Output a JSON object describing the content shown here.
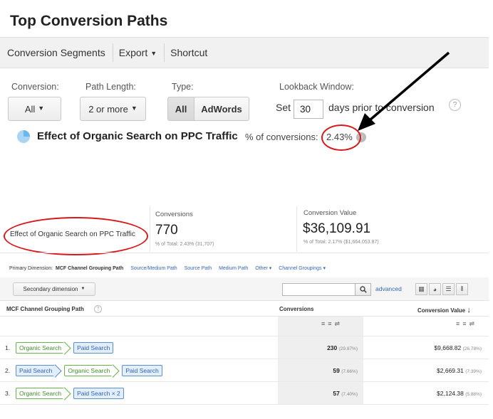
{
  "page_title": "Top Conversion Paths",
  "toolbar": {
    "conversion_segments": "Conversion Segments",
    "export": "Export",
    "shortcut": "Shortcut"
  },
  "filters": {
    "conversion_label": "Conversion:",
    "conversion_value": "All",
    "path_length_label": "Path Length:",
    "path_length_value": "2 or more",
    "type_label": "Type:",
    "type_options": [
      "All",
      "AdWords"
    ],
    "lookback_label": "Lookback Window:",
    "lookback_prefix": "Set",
    "lookback_days": "30",
    "lookback_suffix": "days prior to conversion",
    "help": "?"
  },
  "segment": {
    "name": "Effect of Organic Search on PPC Traffic",
    "pct_label": "% of conversions:",
    "pct_value": "2.43%",
    "close": "×"
  },
  "summary": {
    "segment_label": "Effect of Organic Search on PPC Traffic",
    "conversions_label": "Conversions",
    "conversions_value": "770",
    "conversions_sub": "% of Total: 2.43% (31,707)",
    "value_label": "Conversion Value",
    "value_value": "$36,109.91",
    "value_sub": "% of Total: 2.17% ($1,664,053.87)"
  },
  "dimensions": {
    "label": "Primary Dimension:",
    "active": "MCF Channel Grouping Path",
    "links": [
      "Source/Medium Path",
      "Source Path",
      "Medium Path",
      "Other",
      "Channel Groupings"
    ]
  },
  "secondary": {
    "button": "Secondary dimension",
    "search_placeholder": "",
    "advanced": "advanced"
  },
  "table": {
    "col_path": "MCF Channel Grouping Path",
    "col_conversions": "Conversions",
    "col_value": "Conversion Value",
    "rows": [
      {
        "num": "1.",
        "path": [
          "Organic Search",
          "Paid Search"
        ],
        "conv": "230",
        "conv_pct": "(29.87%)",
        "value": "$9,668.82",
        "value_pct": "(26.78%)"
      },
      {
        "num": "2.",
        "path": [
          "Paid Search",
          "Organic Search",
          "Paid Search"
        ],
        "conv": "59",
        "conv_pct": "(7.66%)",
        "value": "$2,669.31",
        "value_pct": "(7.39%)"
      },
      {
        "num": "3.",
        "path": [
          "Organic Search",
          "Paid Search × 2"
        ],
        "conv": "57",
        "conv_pct": "(7.40%)",
        "value": "$2,124.38",
        "value_pct": "(5.88%)"
      }
    ]
  },
  "colors": {
    "annotation_red": "#d7191c",
    "link_blue": "#3366bb",
    "organic_green": "#3e8d28",
    "paid_blue": "#2f64b4"
  }
}
